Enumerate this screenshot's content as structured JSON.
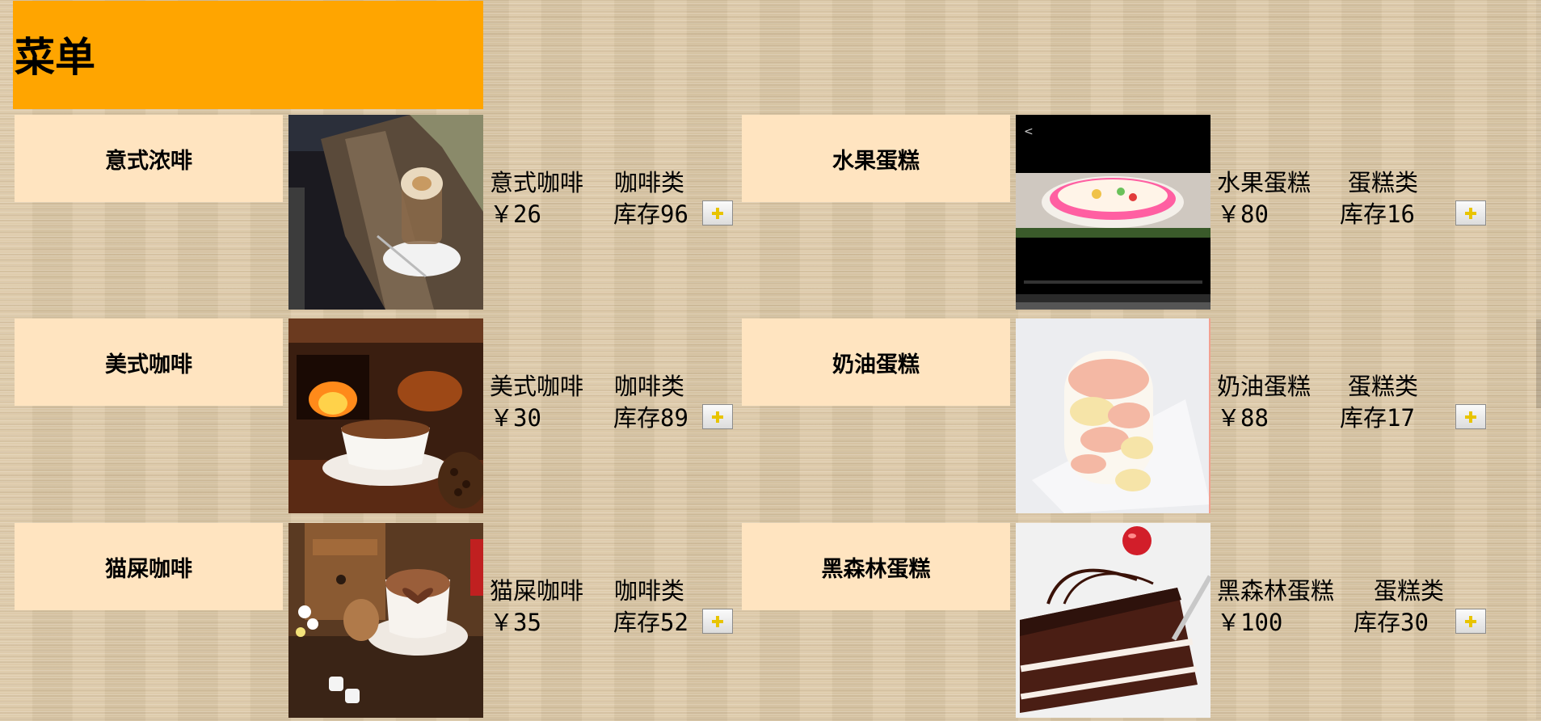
{
  "header": {
    "title": "菜单"
  },
  "items": [
    {
      "name": "意式浓啡",
      "label": "意式咖啡",
      "category": "咖啡类",
      "price": "￥26",
      "stock": "库存96",
      "image": "latte-on-wood-photo"
    },
    {
      "name": "水果蛋糕",
      "label": "水果蛋糕",
      "category": "蛋糕类",
      "price": "￥80",
      "stock": "库存16",
      "image": "fruit-cake-phone-screenshot"
    },
    {
      "name": "美式咖啡",
      "label": "美式咖啡",
      "category": "咖啡类",
      "price": "￥30",
      "stock": "库存89",
      "image": "coffee-cup-fireplace-photo"
    },
    {
      "name": "奶油蛋糕",
      "label": "奶油蛋糕",
      "category": "蛋糕类",
      "price": "￥88",
      "stock": "库存17",
      "image": "cream-cake-photo"
    },
    {
      "name": "猫屎咖啡",
      "label": "猫屎咖啡",
      "category": "咖啡类",
      "price": "￥35",
      "stock": "库存52",
      "image": "heart-latte-grinder-photo"
    },
    {
      "name": "黑森林蛋糕",
      "label": "黑森林蛋糕",
      "category": "蛋糕类",
      "price": "￥100",
      "stock": "库存30",
      "image": "black-forest-cake-photo"
    }
  ],
  "icons": {
    "add": "plus-icon"
  },
  "colors": {
    "header_bg": "#ffa500",
    "label_bg": "#ffe4c0"
  }
}
